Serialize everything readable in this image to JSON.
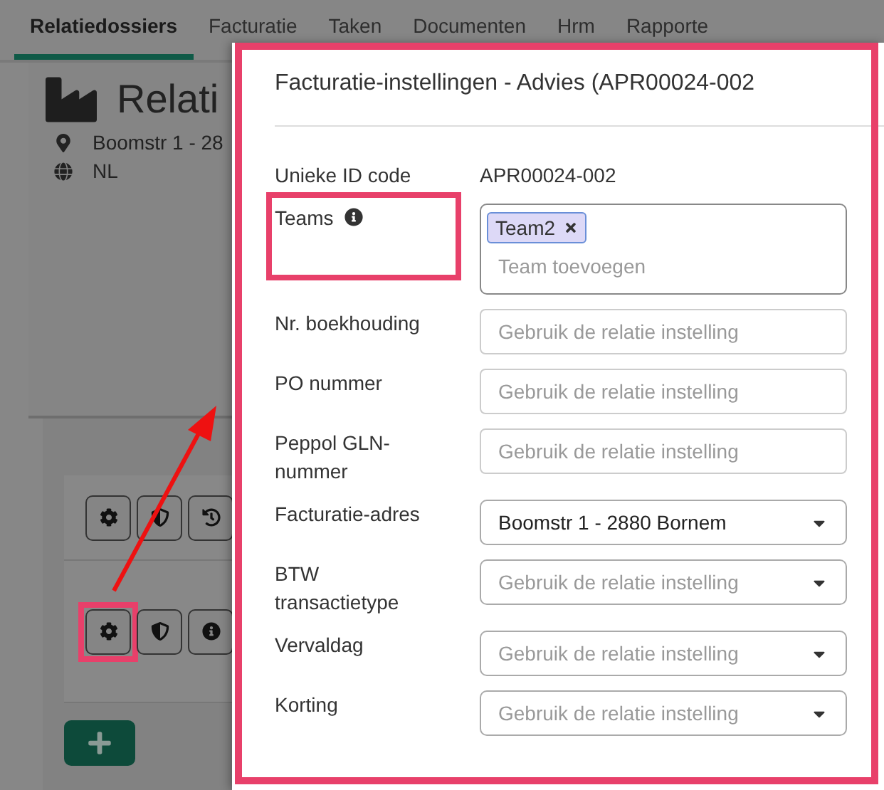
{
  "nav": {
    "tabs": [
      {
        "label": "Relatiedossiers",
        "selected": true
      },
      {
        "label": "Facturatie",
        "selected": false
      },
      {
        "label": "Taken",
        "selected": false
      },
      {
        "label": "Documenten",
        "selected": false
      },
      {
        "label": "Hrm",
        "selected": false
      },
      {
        "label": "Rapporte",
        "selected": false
      }
    ]
  },
  "relation": {
    "title": "Relati",
    "address": "Boomstr 1 - 28",
    "country": "NL"
  },
  "action_rows": [
    {
      "buttons": [
        {
          "kind": "settings",
          "highlighted": false
        },
        {
          "kind": "shield",
          "highlighted": false
        },
        {
          "kind": "history",
          "highlighted": false
        }
      ]
    },
    {
      "buttons": [
        {
          "kind": "settings",
          "highlighted": true
        },
        {
          "kind": "shield",
          "highlighted": false
        },
        {
          "kind": "info",
          "highlighted": false
        }
      ]
    }
  ],
  "dialog": {
    "title": "Facturatie-instellingen - Advies (APR00024-002",
    "fields": [
      {
        "kind": "text",
        "label": "Unieke ID code",
        "value": "APR00024-002"
      },
      {
        "kind": "tags",
        "label": "Teams",
        "info": true,
        "highlighted": true,
        "tags": [
          "Team2"
        ],
        "placeholder": "Team toevoegen"
      },
      {
        "kind": "input",
        "label": "Nr. boekhouding",
        "placeholder": "Gebruik de relatie instelling"
      },
      {
        "kind": "input",
        "label": "PO nummer",
        "placeholder": "Gebruik de relatie instelling"
      },
      {
        "kind": "input",
        "label": "Peppol GLN-nummer",
        "placeholder": "Gebruik de relatie instelling"
      },
      {
        "kind": "select",
        "label": "Facturatie-adres",
        "value": "Boomstr 1 - 2880 Bornem"
      },
      {
        "kind": "select",
        "label": "BTW transactietype",
        "placeholder": "Gebruik de relatie instelling"
      },
      {
        "kind": "select",
        "label": "Vervaldag",
        "placeholder": "Gebruik de relatie instelling"
      },
      {
        "kind": "select",
        "label": "Korting",
        "placeholder": "Gebruik de relatie instelling"
      }
    ]
  }
}
